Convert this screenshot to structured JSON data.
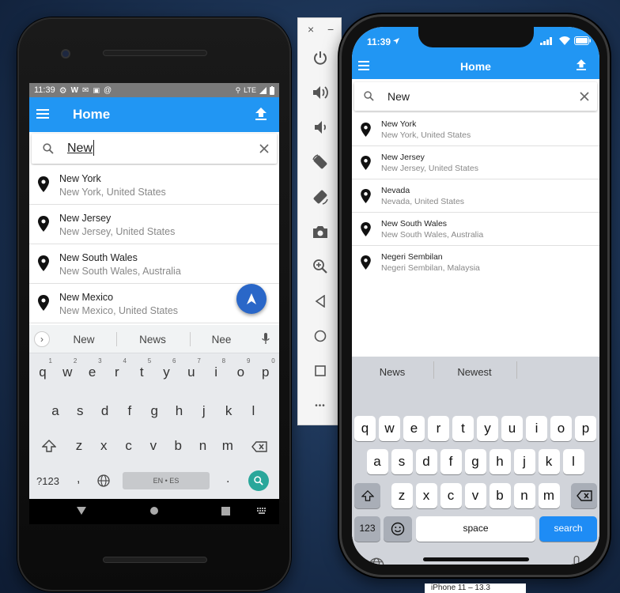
{
  "android": {
    "status": {
      "time": "11:39",
      "network": "LTE"
    },
    "appbar": {
      "title": "Home"
    },
    "search": {
      "value": "New"
    },
    "results": [
      {
        "title": "New York",
        "subtitle": "New York, United States"
      },
      {
        "title": "New Jersey",
        "subtitle": "New Jersey, United States"
      },
      {
        "title": "New South Wales",
        "subtitle": "New South Wales, Australia"
      },
      {
        "title": "New Mexico",
        "subtitle": "New Mexico, United States"
      }
    ],
    "keyboard": {
      "suggestions": [
        "New",
        "News",
        "Nee"
      ],
      "row1": [
        "q",
        "w",
        "e",
        "r",
        "t",
        "y",
        "u",
        "i",
        "o",
        "p"
      ],
      "row1_hints": [
        "1",
        "2",
        "3",
        "4",
        "5",
        "6",
        "7",
        "8",
        "9",
        "0"
      ],
      "row2": [
        "a",
        "s",
        "d",
        "f",
        "g",
        "h",
        "j",
        "k",
        "l"
      ],
      "row3": [
        "z",
        "x",
        "c",
        "v",
        "b",
        "n",
        "m"
      ],
      "symbols_key": "?123",
      "comma_key": ",",
      "space_label": "EN • ES",
      "period_key": "."
    }
  },
  "emulator_toolbar": {
    "close_glyph": "×",
    "minimize_glyph": "−",
    "more_glyph": "•••"
  },
  "iphone": {
    "status": {
      "time": "11:39"
    },
    "appbar": {
      "title": "Home"
    },
    "search": {
      "value": "New"
    },
    "results": [
      {
        "title": "New York",
        "subtitle": "New York, United States"
      },
      {
        "title": "New Jersey",
        "subtitle": "New Jersey, United States"
      },
      {
        "title": "Nevada",
        "subtitle": "Nevada, United States"
      },
      {
        "title": "New South Wales",
        "subtitle": "New South Wales, Australia"
      },
      {
        "title": "Negeri Sembilan",
        "subtitle": "Negeri Sembilan, Malaysia"
      }
    ],
    "keyboard": {
      "suggestions": [
        "News",
        "Newest"
      ],
      "row1": [
        "q",
        "w",
        "e",
        "r",
        "t",
        "y",
        "u",
        "i",
        "o",
        "p"
      ],
      "row2": [
        "a",
        "s",
        "d",
        "f",
        "g",
        "h",
        "j",
        "k",
        "l"
      ],
      "row3": [
        "z",
        "x",
        "c",
        "v",
        "b",
        "n",
        "m"
      ],
      "numbers_key": "123",
      "space_key": "space",
      "search_key": "search"
    }
  },
  "footer": {
    "label": "iPhone 11 – 13.3"
  },
  "colors": {
    "appbar": "#2196f3",
    "fab": "#2a67c8",
    "ios_search_key": "#1e8cf5",
    "accent_search": "#2aa79b"
  }
}
